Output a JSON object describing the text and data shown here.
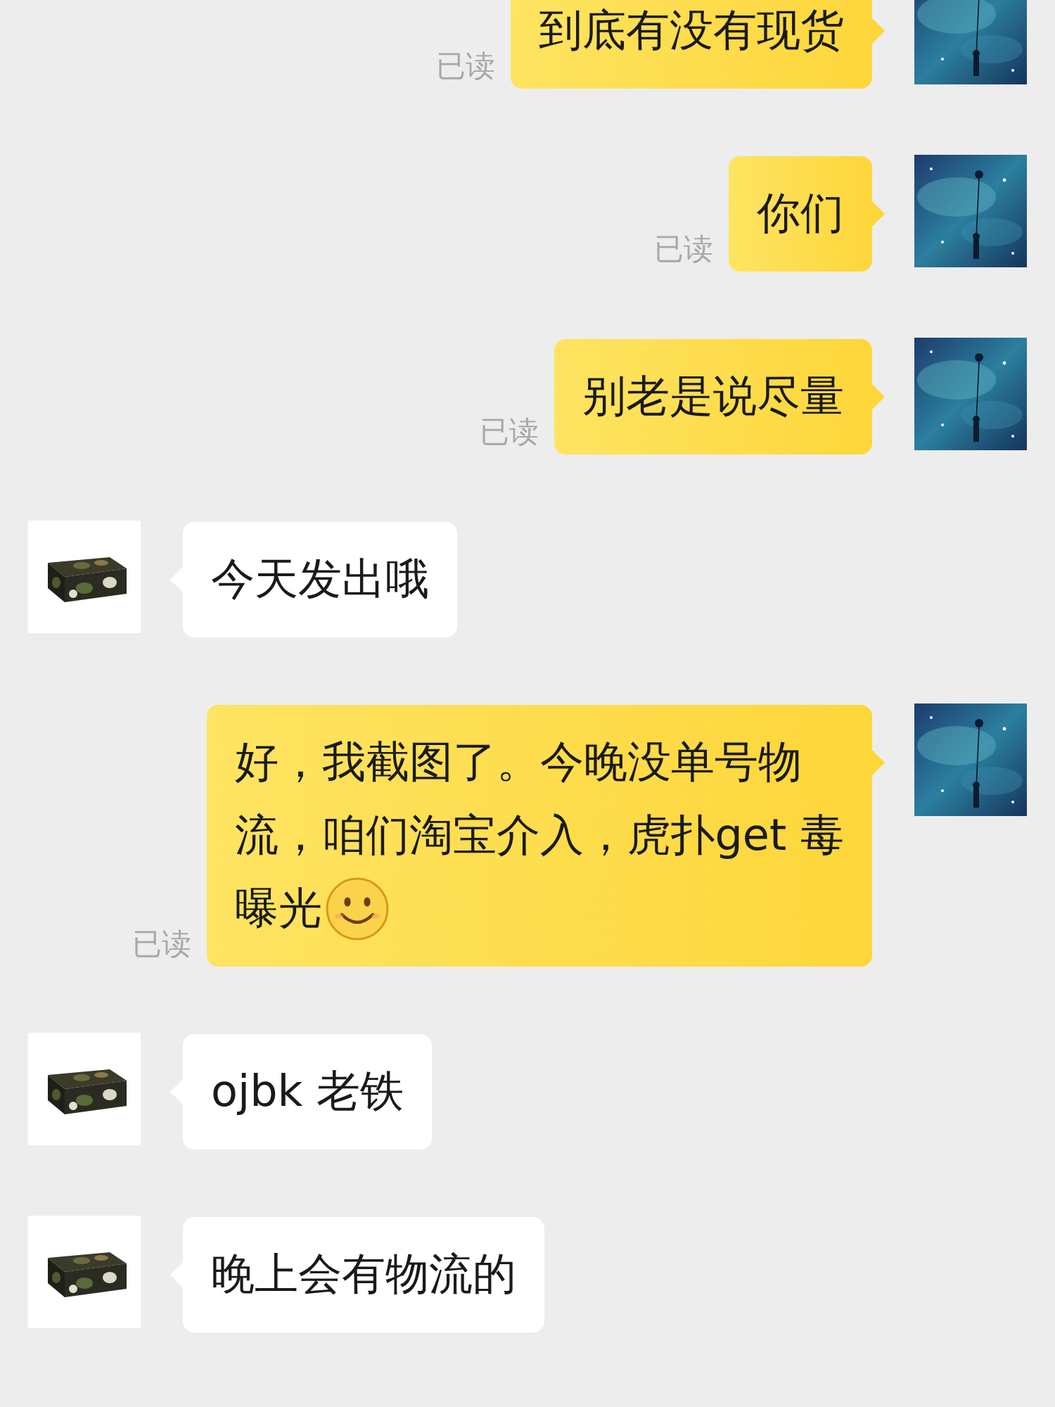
{
  "messages": [
    {
      "kind": "outgoing",
      "lines": [
        "到底有没有现货"
      ],
      "read_receipt": "已读"
    },
    {
      "kind": "outgoing",
      "lines": [
        "你们"
      ],
      "read_receipt": "已读"
    },
    {
      "kind": "outgoing",
      "lines": [
        "别老是说尽量"
      ],
      "read_receipt": "已读"
    },
    {
      "kind": "incoming",
      "lines": [
        "今天发出哦"
      ]
    },
    {
      "kind": "outgoing",
      "lines": [
        "好，我截图了。今晚没单号物",
        "流，咱们淘宝介入，虎扑get 毒",
        "曝光"
      ],
      "read_receipt": "已读",
      "smiley": true
    },
    {
      "kind": "incoming",
      "lines": [
        "ojbk 老铁"
      ]
    },
    {
      "kind": "incoming",
      "lines": [
        "晚上会有物流的"
      ]
    }
  ]
}
